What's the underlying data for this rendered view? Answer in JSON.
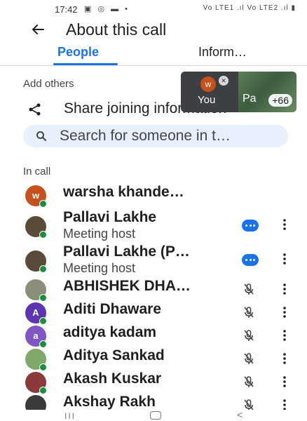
{
  "status_bar": {
    "time": "17:42",
    "left_icons": "▣ ◎ ▬ •",
    "right_icons": "Vo LTE1 .ıl Vo LTE2 .ıl ▮"
  },
  "header": {
    "title": "About this call",
    "back_icon": "arrow-left-icon"
  },
  "tabs": [
    {
      "label": "People",
      "selected": true
    },
    {
      "label": "Inform…",
      "selected": false
    }
  ],
  "add_others": {
    "label": "Add others",
    "share_label": "Share joining information",
    "share_icon": "share-icon"
  },
  "search": {
    "placeholder": "Search for someone in t…"
  },
  "pip": {
    "self_initial": "w",
    "self_label": "You",
    "other_label": "Pa",
    "extra_count": "+66"
  },
  "in_call_label": "In call",
  "participants": [
    {
      "name": "warsha khande…",
      "subtitle": "",
      "avatar": "w",
      "avatar_color": "#c5521e",
      "action": "none"
    },
    {
      "name": "Pallavi Lakhe",
      "subtitle": "Meeting host",
      "avatar": "",
      "avatar_color": "#5a4a3a",
      "action": "more-options"
    },
    {
      "name": "Pallavi Lakhe (P…",
      "subtitle": "Meeting host",
      "avatar": "",
      "avatar_color": "#5a4a3a",
      "action": "more-options"
    },
    {
      "name": "ABHISHEK DHA…",
      "subtitle": "",
      "avatar": "",
      "avatar_color": "#8a8f7a",
      "action": "mic-off"
    },
    {
      "name": "Aditi Dhaware",
      "subtitle": "",
      "avatar": "A",
      "avatar_color": "#5e35b1",
      "action": "mic-off"
    },
    {
      "name": "aditya kadam",
      "subtitle": "",
      "avatar": "a",
      "avatar_color": "#7e57c2",
      "action": "mic-off"
    },
    {
      "name": "Aditya Sankad",
      "subtitle": "",
      "avatar": "",
      "avatar_color": "#7fa86a",
      "action": "mic-off"
    },
    {
      "name": "Akash Kuskar",
      "subtitle": "",
      "avatar": "",
      "avatar_color": "#8a3a3a",
      "action": "mic-off"
    },
    {
      "name": "Akshay Rakh",
      "subtitle": "",
      "avatar": "",
      "avatar_color": "#3a3a3a",
      "action": "mic-off"
    }
  ],
  "nav_bar": {
    "recent": "III",
    "back": "<"
  }
}
